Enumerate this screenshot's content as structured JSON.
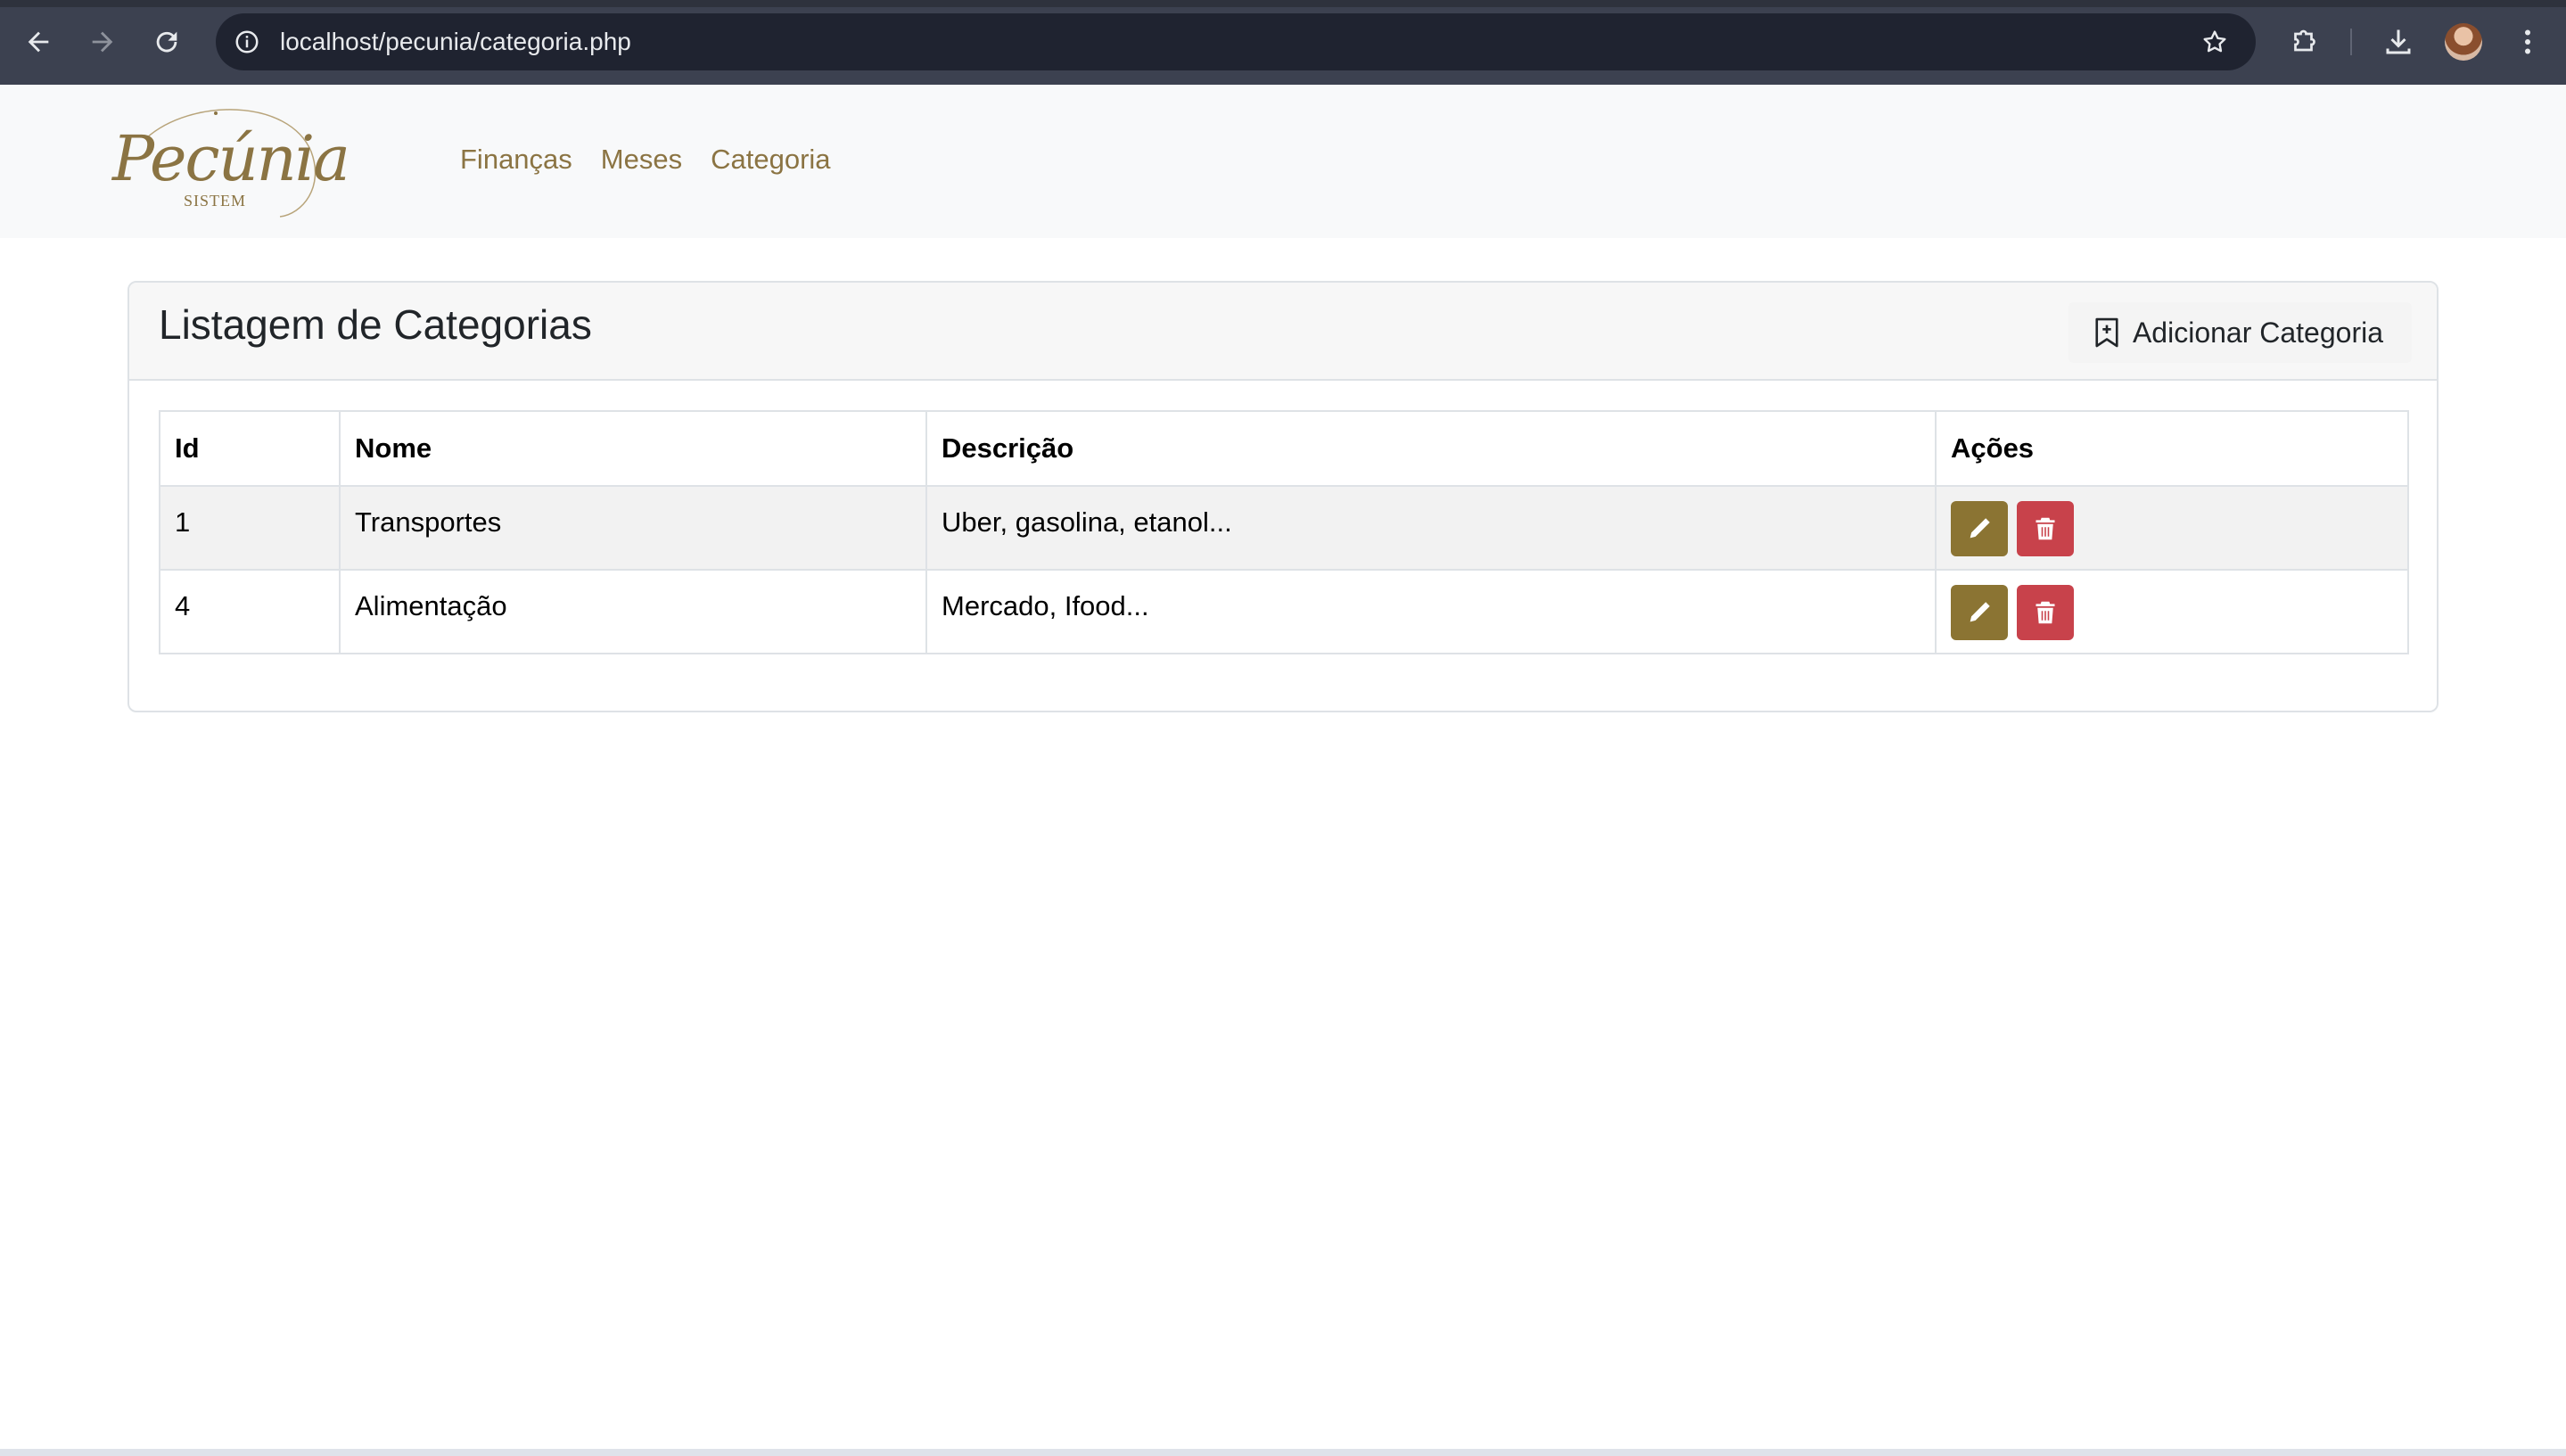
{
  "browser": {
    "url": "localhost/pecunia/categoria.php",
    "icons": [
      "back-arrow-icon",
      "forward-arrow-icon",
      "reload-icon",
      "site-info-icon",
      "star-icon",
      "extensions-icon",
      "download-icon",
      "avatar",
      "kebab-menu-icon"
    ]
  },
  "app": {
    "logo_word": "Pecúnia",
    "logo_sub": "SISTEM",
    "nav": [
      "Finanças",
      "Meses",
      "Categoria"
    ],
    "accent": "#8b7443"
  },
  "card": {
    "title": "Listagem de Categorias",
    "add_button": "Adicionar Categoria"
  },
  "table": {
    "headers": [
      "Id",
      "Nome",
      "Descrição",
      "Ações"
    ],
    "rows": [
      {
        "id": "1",
        "nome": "Transportes",
        "descricao": "Uber, gasolina, etanol..."
      },
      {
        "id": "4",
        "nome": "Alimentação",
        "descricao": "Mercado, Ifood..."
      }
    ],
    "edit_color": "#8b7433",
    "delete_color": "#c8424b"
  }
}
